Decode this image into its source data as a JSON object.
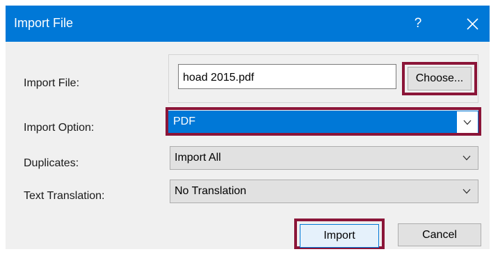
{
  "window": {
    "title": "Import File",
    "help_glyph": "?"
  },
  "fields": {
    "import_file_label": "Import File:",
    "import_file_value": "hoad 2015.pdf",
    "choose_label": "Choose...",
    "import_option_label": "Import Option:",
    "import_option_value": "PDF",
    "duplicates_label": "Duplicates:",
    "duplicates_value": "Import All",
    "text_translation_label": "Text Translation:",
    "text_translation_value": "No Translation"
  },
  "buttons": {
    "import_label": "Import",
    "cancel_label": "Cancel"
  },
  "colors": {
    "titlebar": "#0078d7",
    "highlight": "#8b1538",
    "selected": "#0078d7",
    "dialog_bg": "#f0f0f0"
  },
  "icons": {
    "help": "question-icon",
    "close": "close-icon",
    "dropdown": "chevron-down-icon"
  }
}
